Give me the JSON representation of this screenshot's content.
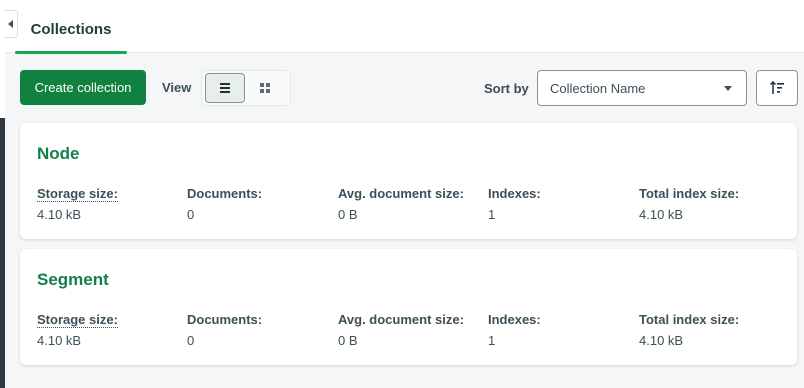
{
  "tabs": [
    {
      "label": "Collections",
      "active": true
    }
  ],
  "toolbar": {
    "create_label": "Create collection",
    "view_label": "View",
    "sort_label": "Sort by",
    "sort_value": "Collection Name",
    "view_modes": [
      "list-icon",
      "grid-icon"
    ],
    "active_view": "list"
  },
  "stat_labels": {
    "storage": "Storage size:",
    "documents": "Documents:",
    "avg": "Avg. document size:",
    "indexes": "Indexes:",
    "total_index": "Total index size:"
  },
  "collections": [
    {
      "name": "Node",
      "storage": "4.10 kB",
      "documents": "0",
      "avg": "0 B",
      "indexes": "1",
      "total_index": "4.10 kB"
    },
    {
      "name": "Segment",
      "storage": "4.10 kB",
      "documents": "0",
      "avg": "0 B",
      "indexes": "1",
      "total_index": "4.10 kB"
    }
  ],
  "colors": {
    "accent": "#13aa52",
    "primary_button": "#11813f",
    "title_green": "#13804a"
  }
}
